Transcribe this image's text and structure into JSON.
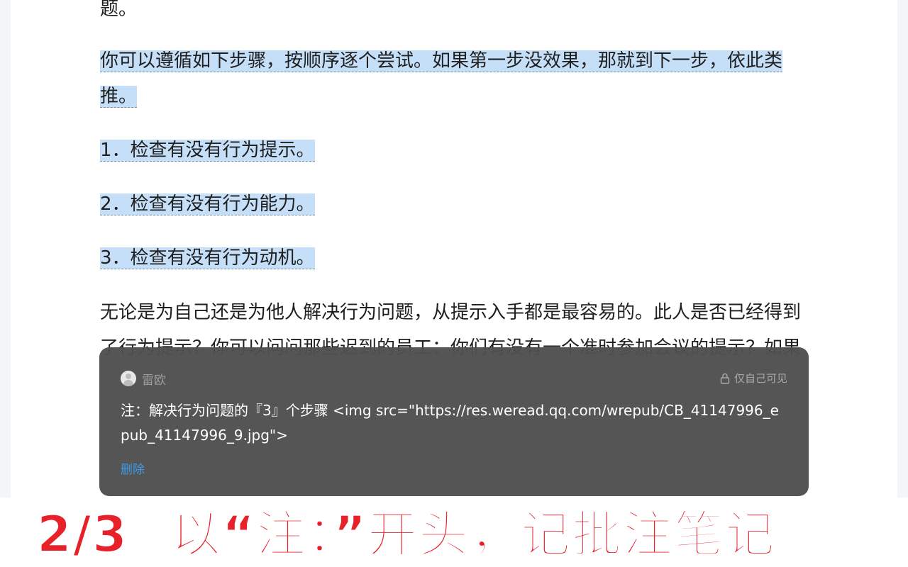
{
  "book": {
    "paragraphs": [
      {
        "line1": "题。",
        "line2": ""
      },
      {
        "line1": "你可以遵循如下步骤，按顺序逐个尝试。如果第一步没效果，那就到下一步，依此类",
        "line2": "推。"
      },
      {
        "line1": "1．检查有没有行为提示。"
      },
      {
        "line1": "2．检查有没有行为能力。"
      },
      {
        "line1": "3．检查有没有行为动机。"
      },
      {
        "line1": "无论是为自己还是为他人解决行为问题，从提示入手都是最容易的。此人是否已经得到",
        "line2": "了行为提示？你可以问问那些迟到的员工：你们有没有一个准时参加会议的提示？如果"
      }
    ]
  },
  "note_popup": {
    "username": "雷欧",
    "privacy_label": "仅自己可见",
    "note_text": "注：解决行为问题的『3』个步骤 <img src=\"https://res.weread.qq.com/wrepub/CB_41147996_epub_41147996_9.jpg\">",
    "delete_label": "删除"
  },
  "caption": {
    "step": "2/3",
    "text": "以“注：”开头，记批注笔记"
  },
  "icons": {
    "avatar": "avatar-icon",
    "lock": "lock-icon"
  },
  "colors": {
    "highlight": "#c6dff8",
    "popup_bg": "#505050",
    "delete_link": "#3d9be9",
    "caption": "#e8202a"
  }
}
